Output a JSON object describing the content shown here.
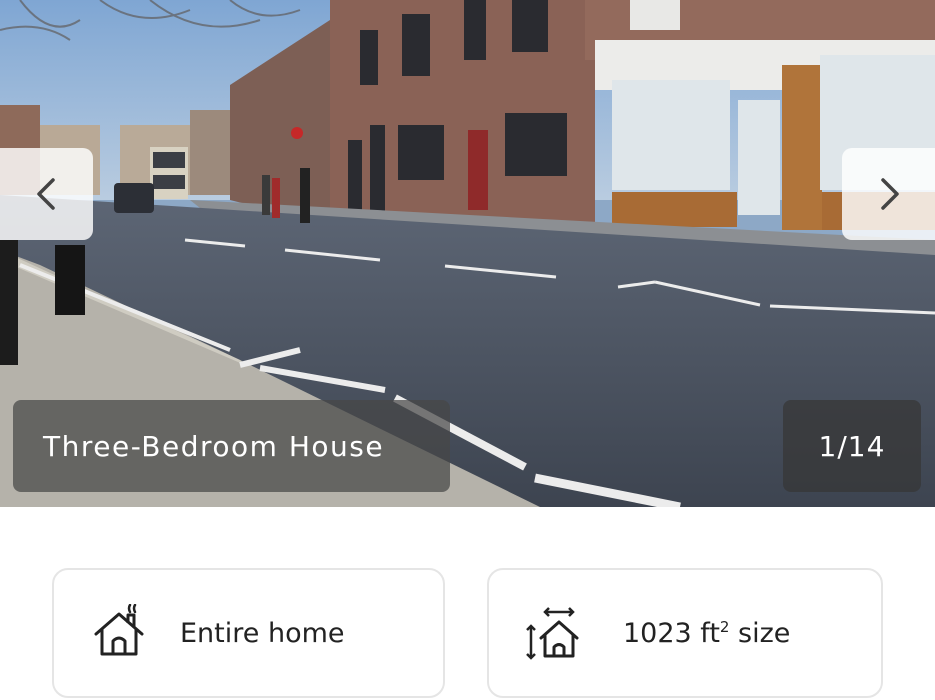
{
  "gallery": {
    "caption": "Three-Bedroom House",
    "counter": "1/14",
    "current_photo": 1,
    "total_photos": 14
  },
  "info_cards": {
    "home_type": "Entire home",
    "size_value": "1023 ft",
    "size_exp": "2",
    "size_suffix": " size"
  },
  "icons": {
    "prev": "chevron-left-icon",
    "next": "chevron-right-icon",
    "home": "house-chimney-icon",
    "size": "house-dimensions-icon"
  }
}
